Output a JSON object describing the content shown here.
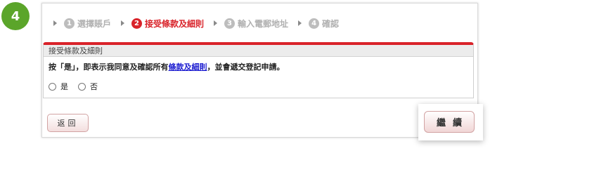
{
  "step_badge": "4",
  "stepper": {
    "steps": [
      {
        "num": "1",
        "label": "選擇賬戶"
      },
      {
        "num": "2",
        "label": "接受條款及細則"
      },
      {
        "num": "3",
        "label": "輸入電郵地址"
      },
      {
        "num": "4",
        "label": "確認"
      }
    ]
  },
  "panel": {
    "title": "接受條款及細則",
    "text_before": "按「是」，即表示我同意及確認所有",
    "link_text": "條款及細則",
    "text_after": "，並會遞交登記申請。",
    "option_yes": "是",
    "option_no": "否"
  },
  "buttons": {
    "back": "返回",
    "continue": "繼續"
  },
  "colors": {
    "accent": "#d9232a",
    "badge": "#5ba52a",
    "link": "#1a1ad0"
  }
}
